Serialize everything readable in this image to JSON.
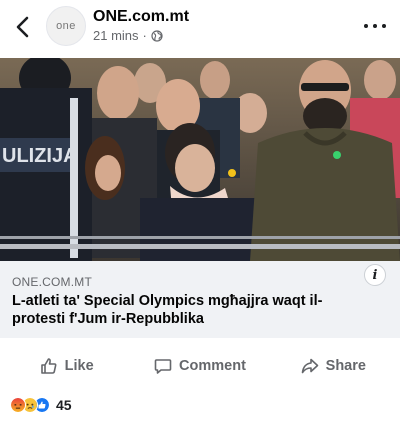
{
  "post": {
    "page_name": "ONE.com.mt",
    "time": "21 mins",
    "separator": "·",
    "avatar_text": "one",
    "privacy_icon": "globe-icon"
  },
  "link_preview": {
    "domain": "ONE.COM.MT",
    "headline": "L-atleti ta' Special Olympics mgħajjra waqt il-protesti f'Jum ir-Repubblika",
    "badge": "i"
  },
  "photo": {
    "police_vest_text": "ULIZIJA"
  },
  "actions": {
    "like": "Like",
    "comment": "Comment",
    "share": "Share"
  },
  "reactions": {
    "types": [
      "angry",
      "sad",
      "like"
    ],
    "count": "45"
  },
  "colors": {
    "link_box_bg": "#f0f2f5",
    "muted_text": "#65676b",
    "like_blue": "#1877f2",
    "angry_orange": "#f0623b",
    "sad_yellow": "#f7b125"
  }
}
